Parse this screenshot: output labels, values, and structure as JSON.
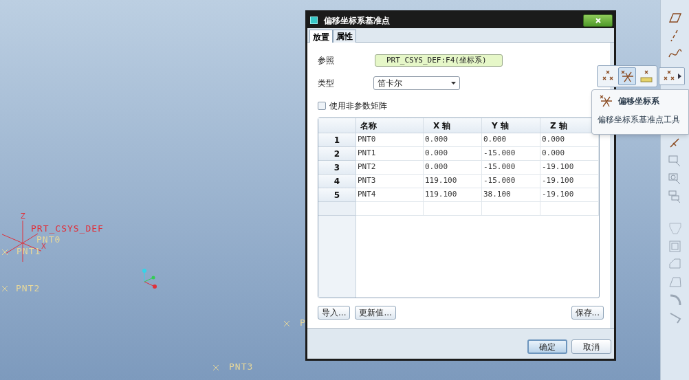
{
  "canvas": {
    "csys": {
      "name": "PRT_CSYS_DEF",
      "axes": [
        "Z",
        "X"
      ]
    },
    "points": [
      {
        "text": "PNT0",
        "marker": false
      },
      {
        "text": "PNT1",
        "marker": true
      },
      {
        "text": "PNT2",
        "marker": true
      },
      {
        "text": "P",
        "marker": true
      },
      {
        "text": "PNT3",
        "marker": true
      }
    ]
  },
  "dialog": {
    "title": "偏移坐标系基准点",
    "tabs": [
      {
        "label": "放置",
        "selected": true
      },
      {
        "label": "属性",
        "selected": false
      }
    ],
    "reference": {
      "label": "参照",
      "value": "PRT_CSYS_DEF:F4(坐标系)"
    },
    "type": {
      "label": "类型",
      "value": "笛卡尔"
    },
    "non_parametric": {
      "label": "使用非参数矩阵",
      "checked": false
    },
    "table": {
      "columns": [
        "名称",
        "X 轴",
        "Y 轴",
        "Z 轴"
      ],
      "rows": [
        {
          "index": "1",
          "cells": [
            "PNT0",
            "0.000",
            "0.000",
            "0.000"
          ]
        },
        {
          "index": "2",
          "cells": [
            "PNT1",
            "0.000",
            "-15.000",
            "0.000"
          ]
        },
        {
          "index": "3",
          "cells": [
            "PNT2",
            "0.000",
            "-15.000",
            "-19.100"
          ]
        },
        {
          "index": "4",
          "cells": [
            "PNT3",
            "119.100",
            "-15.000",
            "-19.100"
          ]
        },
        {
          "index": "5",
          "cells": [
            "PNT4",
            "119.100",
            "38.100",
            "-19.100"
          ]
        }
      ]
    },
    "buttons": [
      "导入...",
      "更新值...",
      "保存..."
    ],
    "footer_buttons": [
      {
        "label": "确定",
        "default": true
      },
      {
        "label": "取消",
        "default": false
      }
    ]
  },
  "flyout": {
    "items": [
      {
        "kind": "point",
        "selected": false
      },
      {
        "kind": "offset-csys",
        "selected": true
      },
      {
        "kind": "field-point",
        "selected": false
      },
      {
        "kind": "point-group",
        "selected": false
      }
    ]
  },
  "tooltip": {
    "title": "偏移坐标系",
    "description": "偏移坐标系基准点工具"
  }
}
